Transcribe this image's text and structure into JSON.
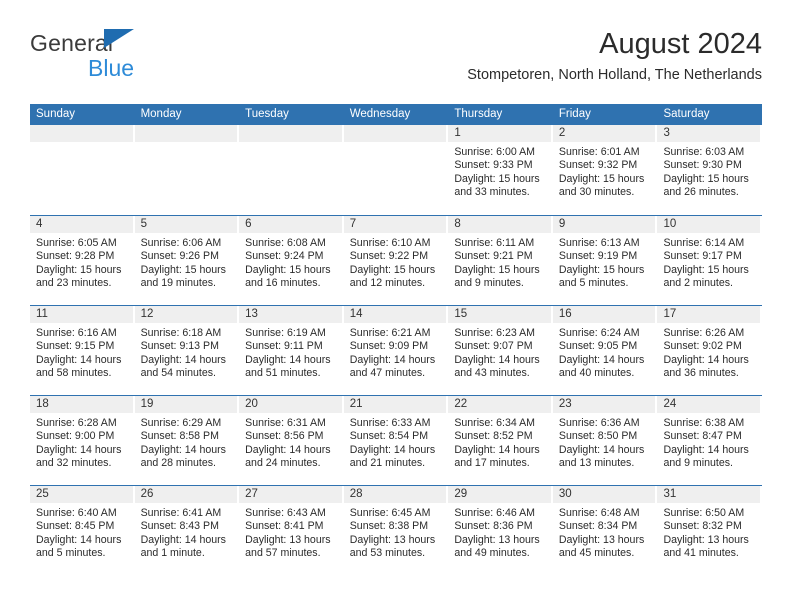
{
  "brand": {
    "name_top": "General",
    "name_bottom": "Blue",
    "triangle_color": "#1f6cb0",
    "blue_text_color": "#2e8bd8"
  },
  "header": {
    "title": "August 2024",
    "location": "Stompetoren, North Holland, The Netherlands"
  },
  "theme": {
    "header_blue": "#2f72b0",
    "day_band_gray": "#efefef",
    "text": "#2b2b2b"
  },
  "calendar": {
    "weekday_headers": [
      "Sunday",
      "Monday",
      "Tuesday",
      "Wednesday",
      "Thursday",
      "Friday",
      "Saturday"
    ],
    "weeks": [
      [
        {
          "day": "",
          "lines": []
        },
        {
          "day": "",
          "lines": []
        },
        {
          "day": "",
          "lines": []
        },
        {
          "day": "",
          "lines": []
        },
        {
          "day": "1",
          "lines": [
            "Sunrise: 6:00 AM",
            "Sunset: 9:33 PM",
            "Daylight: 15 hours",
            "and 33 minutes."
          ]
        },
        {
          "day": "2",
          "lines": [
            "Sunrise: 6:01 AM",
            "Sunset: 9:32 PM",
            "Daylight: 15 hours",
            "and 30 minutes."
          ]
        },
        {
          "day": "3",
          "lines": [
            "Sunrise: 6:03 AM",
            "Sunset: 9:30 PM",
            "Daylight: 15 hours",
            "and 26 minutes."
          ]
        }
      ],
      [
        {
          "day": "4",
          "lines": [
            "Sunrise: 6:05 AM",
            "Sunset: 9:28 PM",
            "Daylight: 15 hours",
            "and 23 minutes."
          ]
        },
        {
          "day": "5",
          "lines": [
            "Sunrise: 6:06 AM",
            "Sunset: 9:26 PM",
            "Daylight: 15 hours",
            "and 19 minutes."
          ]
        },
        {
          "day": "6",
          "lines": [
            "Sunrise: 6:08 AM",
            "Sunset: 9:24 PM",
            "Daylight: 15 hours",
            "and 16 minutes."
          ]
        },
        {
          "day": "7",
          "lines": [
            "Sunrise: 6:10 AM",
            "Sunset: 9:22 PM",
            "Daylight: 15 hours",
            "and 12 minutes."
          ]
        },
        {
          "day": "8",
          "lines": [
            "Sunrise: 6:11 AM",
            "Sunset: 9:21 PM",
            "Daylight: 15 hours",
            "and 9 minutes."
          ]
        },
        {
          "day": "9",
          "lines": [
            "Sunrise: 6:13 AM",
            "Sunset: 9:19 PM",
            "Daylight: 15 hours",
            "and 5 minutes."
          ]
        },
        {
          "day": "10",
          "lines": [
            "Sunrise: 6:14 AM",
            "Sunset: 9:17 PM",
            "Daylight: 15 hours",
            "and 2 minutes."
          ]
        }
      ],
      [
        {
          "day": "11",
          "lines": [
            "Sunrise: 6:16 AM",
            "Sunset: 9:15 PM",
            "Daylight: 14 hours",
            "and 58 minutes."
          ]
        },
        {
          "day": "12",
          "lines": [
            "Sunrise: 6:18 AM",
            "Sunset: 9:13 PM",
            "Daylight: 14 hours",
            "and 54 minutes."
          ]
        },
        {
          "day": "13",
          "lines": [
            "Sunrise: 6:19 AM",
            "Sunset: 9:11 PM",
            "Daylight: 14 hours",
            "and 51 minutes."
          ]
        },
        {
          "day": "14",
          "lines": [
            "Sunrise: 6:21 AM",
            "Sunset: 9:09 PM",
            "Daylight: 14 hours",
            "and 47 minutes."
          ]
        },
        {
          "day": "15",
          "lines": [
            "Sunrise: 6:23 AM",
            "Sunset: 9:07 PM",
            "Daylight: 14 hours",
            "and 43 minutes."
          ]
        },
        {
          "day": "16",
          "lines": [
            "Sunrise: 6:24 AM",
            "Sunset: 9:05 PM",
            "Daylight: 14 hours",
            "and 40 minutes."
          ]
        },
        {
          "day": "17",
          "lines": [
            "Sunrise: 6:26 AM",
            "Sunset: 9:02 PM",
            "Daylight: 14 hours",
            "and 36 minutes."
          ]
        }
      ],
      [
        {
          "day": "18",
          "lines": [
            "Sunrise: 6:28 AM",
            "Sunset: 9:00 PM",
            "Daylight: 14 hours",
            "and 32 minutes."
          ]
        },
        {
          "day": "19",
          "lines": [
            "Sunrise: 6:29 AM",
            "Sunset: 8:58 PM",
            "Daylight: 14 hours",
            "and 28 minutes."
          ]
        },
        {
          "day": "20",
          "lines": [
            "Sunrise: 6:31 AM",
            "Sunset: 8:56 PM",
            "Daylight: 14 hours",
            "and 24 minutes."
          ]
        },
        {
          "day": "21",
          "lines": [
            "Sunrise: 6:33 AM",
            "Sunset: 8:54 PM",
            "Daylight: 14 hours",
            "and 21 minutes."
          ]
        },
        {
          "day": "22",
          "lines": [
            "Sunrise: 6:34 AM",
            "Sunset: 8:52 PM",
            "Daylight: 14 hours",
            "and 17 minutes."
          ]
        },
        {
          "day": "23",
          "lines": [
            "Sunrise: 6:36 AM",
            "Sunset: 8:50 PM",
            "Daylight: 14 hours",
            "and 13 minutes."
          ]
        },
        {
          "day": "24",
          "lines": [
            "Sunrise: 6:38 AM",
            "Sunset: 8:47 PM",
            "Daylight: 14 hours",
            "and 9 minutes."
          ]
        }
      ],
      [
        {
          "day": "25",
          "lines": [
            "Sunrise: 6:40 AM",
            "Sunset: 8:45 PM",
            "Daylight: 14 hours",
            "and 5 minutes."
          ]
        },
        {
          "day": "26",
          "lines": [
            "Sunrise: 6:41 AM",
            "Sunset: 8:43 PM",
            "Daylight: 14 hours",
            "and 1 minute."
          ]
        },
        {
          "day": "27",
          "lines": [
            "Sunrise: 6:43 AM",
            "Sunset: 8:41 PM",
            "Daylight: 13 hours",
            "and 57 minutes."
          ]
        },
        {
          "day": "28",
          "lines": [
            "Sunrise: 6:45 AM",
            "Sunset: 8:38 PM",
            "Daylight: 13 hours",
            "and 53 minutes."
          ]
        },
        {
          "day": "29",
          "lines": [
            "Sunrise: 6:46 AM",
            "Sunset: 8:36 PM",
            "Daylight: 13 hours",
            "and 49 minutes."
          ]
        },
        {
          "day": "30",
          "lines": [
            "Sunrise: 6:48 AM",
            "Sunset: 8:34 PM",
            "Daylight: 13 hours",
            "and 45 minutes."
          ]
        },
        {
          "day": "31",
          "lines": [
            "Sunrise: 6:50 AM",
            "Sunset: 8:32 PM",
            "Daylight: 13 hours",
            "and 41 minutes."
          ]
        }
      ]
    ]
  }
}
